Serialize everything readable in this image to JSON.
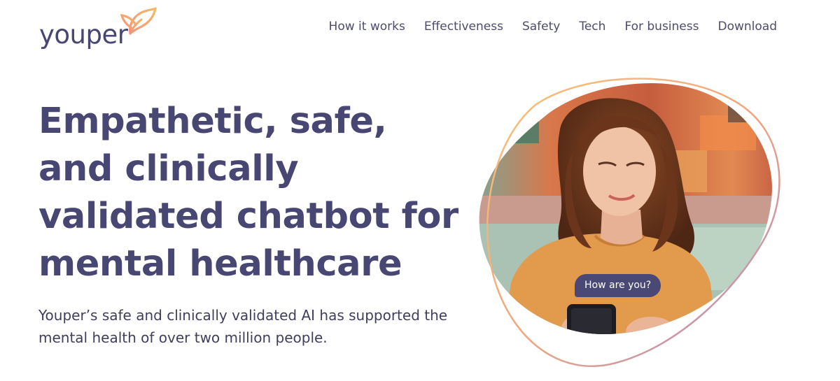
{
  "header": {
    "logo_text": "youper",
    "nav": [
      {
        "label": "How it works"
      },
      {
        "label": "Effectiveness"
      },
      {
        "label": "Safety"
      },
      {
        "label": "Tech"
      },
      {
        "label": "For business"
      },
      {
        "label": "Download"
      }
    ]
  },
  "hero": {
    "title": "Empathetic, safe, and clinically validated chatbot for mental healthcare",
    "subtitle": "Youper’s safe and clinically validated AI has supported the mental health of over two million people.",
    "chat_bubble": "How are you?"
  },
  "colors": {
    "brand_text": "#484672",
    "accent_orange": "#f4a06f",
    "accent_purple": "#a98ac9",
    "bubble_bg": "#4a4874"
  }
}
